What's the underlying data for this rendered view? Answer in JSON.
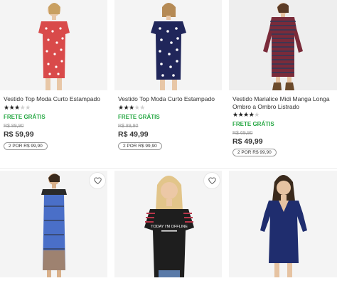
{
  "products": [
    {
      "title": "Vestido Top Moda Curto Estampado",
      "rating_stars": 3.5,
      "shipping": "FRETE GRÁTIS",
      "old_price": "R$ 89,90",
      "price": "R$ 59,99",
      "promo": "2 POR R$ 99,90",
      "image": "red-white-print-short-dress",
      "colors": {
        "dress": "#d94a4a",
        "accent": "#ffffff"
      }
    },
    {
      "title": "Vestido Top Moda Curto Estampado",
      "rating_stars": 3.5,
      "shipping": "FRETE GRÁTIS",
      "old_price": "R$ 89,90",
      "price": "R$ 49,99",
      "promo": "2 POR R$ 99,90",
      "image": "navy-white-print-short-dress",
      "colors": {
        "dress": "#20265a",
        "accent": "#ffffff"
      }
    },
    {
      "title": "Vestido Marialice Midi Manga Longa Ombro a Ombro Listrado",
      "rating_stars": 4.5,
      "shipping": "FRETE GRÁTIS",
      "old_price": "R$ 69,90",
      "price": "R$ 49,99",
      "promo": "2 POR R$ 99,90",
      "image": "striped-midi-long-sleeve-dress",
      "colors": {
        "dress": "#7a2b3a",
        "accent": "#2c3a5a"
      }
    },
    {
      "image": "blue-printed-off-shoulder-maxi-dress",
      "colors": {
        "dress": "#4a6fc8",
        "accent": "#2a2a2a"
      }
    },
    {
      "image": "black-tshirt-today-im-offline",
      "shirt_text": "TODAY I'M OFFLINE",
      "colors": {
        "dress": "#1e1e1e",
        "accent": "#b9364a"
      }
    },
    {
      "image": "navy-fitted-midi-dress",
      "colors": {
        "dress": "#1f2d6e",
        "accent": "#1f2d6e"
      }
    }
  ],
  "icons": {
    "favorite": "heart-icon",
    "rating": "star-icon"
  }
}
